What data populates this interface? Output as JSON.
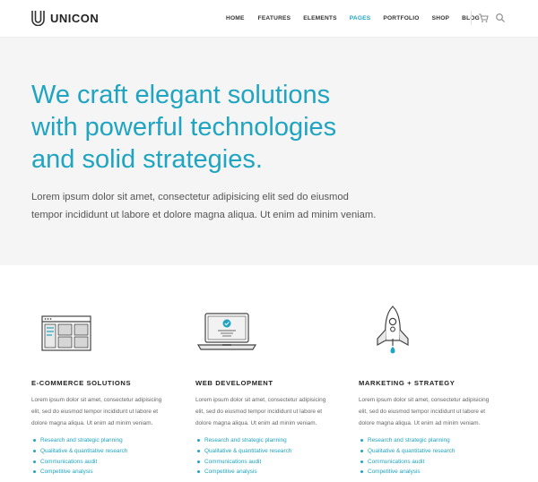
{
  "brand": {
    "name": "UNICON",
    "accent": "#1fa4c1"
  },
  "nav": {
    "items": [
      {
        "label": "HOME",
        "active": false
      },
      {
        "label": "FEATURES",
        "active": false
      },
      {
        "label": "ELEMENTS",
        "active": false
      },
      {
        "label": "PAGES",
        "active": true
      },
      {
        "label": "PORTFOLIO",
        "active": false
      },
      {
        "label": "SHOP",
        "active": false
      },
      {
        "label": "BLOG",
        "active": false
      }
    ],
    "icons": [
      "cart-icon",
      "search-icon"
    ]
  },
  "hero": {
    "title_lines": [
      "We craft elegant solutions",
      "with powerful technologies",
      "and solid strategies."
    ],
    "text_lines": [
      "Lorem ipsum dolor sit amet, consectetur adipisicing elit sed do eiusmod",
      "tempor incididunt ut labore et dolore magna aliqua. Ut enim ad minim veniam."
    ]
  },
  "features": [
    {
      "icon": "browser-layout-icon",
      "title": "E-COMMERCE SOLUTIONS",
      "text_lines": [
        "Lorem ipsum dolor sit amet, consectetur adipisicing",
        "elit, sed do eiusmod tempor incididunt ut labore et",
        "dolore magna aliqua. Ut enim ad minim veniam."
      ],
      "list": [
        "Research and strategic planning",
        "Qualitative & quantitative research",
        "Communications audit",
        "Competitive analysis"
      ]
    },
    {
      "icon": "laptop-icon",
      "title": "WEB DEVELOPMENT",
      "text_lines": [
        "Lorem ipsum dolor sit amet, consectetur adipisicing",
        "elit, sed do eiusmod tempor incididunt ut labore et",
        "dolore magna aliqua. Ut enim ad minim veniam."
      ],
      "list": [
        "Research and strategic planning",
        "Qualitative & quantitative research",
        "Communications audit",
        "Competitive analysis"
      ]
    },
    {
      "icon": "rocket-icon",
      "title": "MARKETING + STRATEGY",
      "text_lines": [
        "Lorem ipsum dolor sit amet, consectetur adipisicing",
        "elit, sed do eiusmod tempor incididunt ut labore et",
        "dolore magna aliqua. Ut enim ad minim veniam."
      ],
      "list": [
        "Research and strategic planning",
        "Qualitative & quantitative research",
        "Communications audit",
        "Competitive analysis"
      ]
    }
  ]
}
